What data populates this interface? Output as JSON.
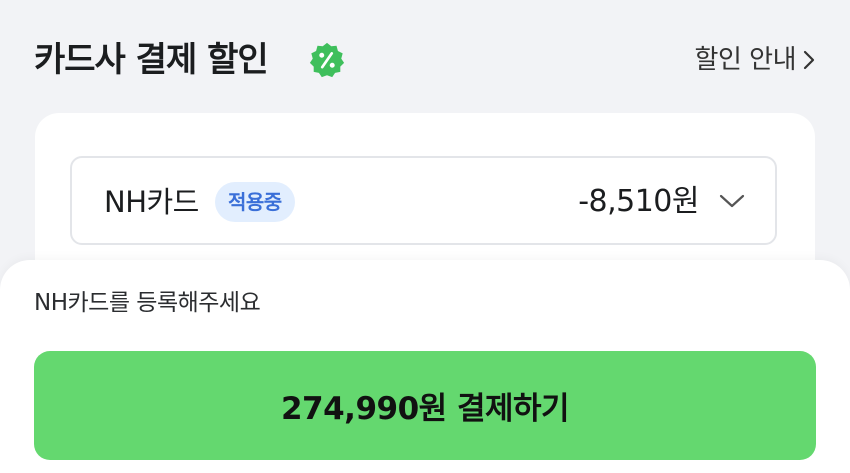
{
  "header": {
    "title": "카드사 결제 할인",
    "badge_icon": "percent-badge-icon",
    "info_link_label": "할인 안내"
  },
  "card_select": {
    "card_name": "NH카드",
    "status": "적용중",
    "discount": "-8,510원",
    "chevron_icon": "chevron-down-icon"
  },
  "bottom_sheet": {
    "notice": "NH카드를 등록해주세요",
    "pay_button_label": "274,990원 결제하기"
  },
  "colors": {
    "badge_green": "#3fbf5c",
    "pay_button_green": "#64d86f",
    "status_bg": "#e2eefe",
    "status_text": "#3a6fd8"
  }
}
